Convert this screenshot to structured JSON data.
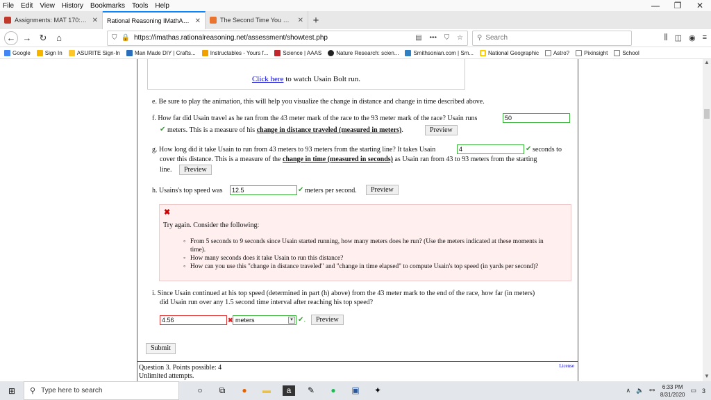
{
  "menu": [
    "File",
    "Edit",
    "View",
    "History",
    "Bookmarks",
    "Tools",
    "Help"
  ],
  "tabs": [
    {
      "label": "Assignments: MAT 170: Precalc",
      "color": "#c0392b"
    },
    {
      "label": "Rational Reasoning IMathAS Asses",
      "color": "#ffffff"
    },
    {
      "label": "The Second Time You Watched",
      "color": "#e8742f"
    }
  ],
  "url": "https://imathas.rationalreasoning.net/assessment/showtest.php",
  "search_placeholder": "Search",
  "bookmarks": [
    {
      "label": "Google",
      "color": "#4285f4"
    },
    {
      "label": "Sign In",
      "color": "#f5b400"
    },
    {
      "label": "ASURITE Sign-In",
      "color": "#ffc627"
    },
    {
      "label": "Man Made DIY | Crafts...",
      "color": "#2a6ebb"
    },
    {
      "label": "Instructables - Yours f...",
      "color": "#f0a000"
    },
    {
      "label": "Science | AAAS",
      "color": "#c1272d"
    },
    {
      "label": "Nature Research: scien...",
      "color": "#222222"
    },
    {
      "label": "Smithsonian.com | Sm...",
      "color": "#2f7fc1"
    },
    {
      "label": "National Geographic",
      "color": "#ffcc00"
    },
    {
      "label": "Astro?",
      "color": "#888888"
    },
    {
      "label": "Pixinsight",
      "color": "#888888"
    },
    {
      "label": "School",
      "color": "#888888"
    }
  ],
  "video_link": {
    "link_text": "Click here",
    "rest": " to watch Usain Bolt run."
  },
  "q_e": "e. Be sure to play the animation, this will help you visualize the change in distance and change in time described above.",
  "q_f": {
    "text": "f. How far did Usain travel as he ran from the 43 meter mark of the race to the 93 meter mark of the race? Usain runs",
    "value": "50",
    "after": "meters. This is a measure of his",
    "ul": "change in distance traveled (measured in meters)",
    "end": "."
  },
  "q_g": {
    "text": "g. How long did it take Usain to run from 43 meters to 93 meters from the starting line? It takes Usain",
    "value": "4",
    "after": "seconds to",
    "line2_a": "cover this distance. This is a measure of the",
    "ul": "change in time (measured in seconds)",
    "line2_b": "as Usain ran from 43 to 93 meters from the starting",
    "line3": "line."
  },
  "q_h": {
    "text": "h. Usains's top speed was",
    "value": "12.5",
    "after": "meters per second."
  },
  "try_again": {
    "heading": "Try again. Consider the following:",
    "bullets": [
      "From 5 seconds to 9 seconds since Usain started running, how many meters does he run? (Use the meters indicated at these moments in time).",
      "How many seconds does it take Usain to run this distance?",
      "How can you use this \"change in distance traveled\" and \"change in time elapsed\" to compute Usain's top speed (in yards per second)?"
    ]
  },
  "q_i": {
    "line1": "i. Since Usain continued at his top speed (determined in part (h) above) from the 43 meter mark to the end of the race, how far (in meters)",
    "line2": "did Usain run over any 1.5 second time interval after reaching his top speed?",
    "value": "4.56",
    "unit": "meters"
  },
  "preview_label": "Preview",
  "submit_label": "Submit",
  "q3": {
    "line1": "Question 3. Points possible: 4",
    "line2": "Unlimited attempts.",
    "license": "License"
  },
  "taskbar": {
    "search": "Type here to search",
    "time": "6:33 PM",
    "date": "8/31/2020",
    "notif": "3"
  }
}
